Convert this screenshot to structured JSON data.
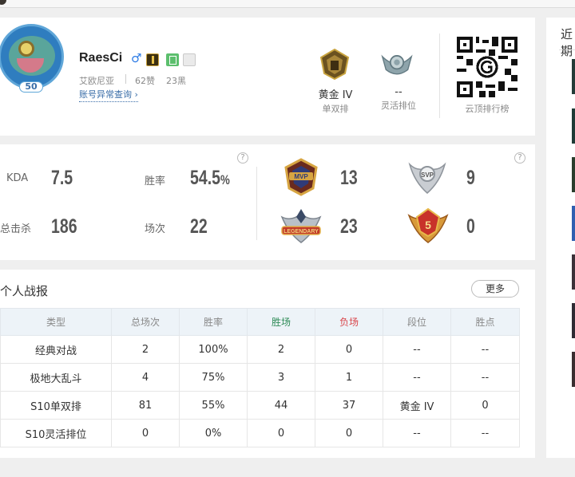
{
  "profile": {
    "name": "RaesCi",
    "gender_symbol": "♂",
    "server": "艾欧尼亚",
    "likes": "62赞",
    "blacks": "23黑",
    "account_check": "账号异常查询 ›",
    "level": "50"
  },
  "ranks": [
    {
      "title": "黄金 IV",
      "subtitle": "单双排",
      "emblem": "gold-rank-emblem"
    },
    {
      "title": "--",
      "subtitle": "灵活排位",
      "emblem": "unranked-emblem"
    }
  ],
  "qr": {
    "caption": "云顶排行榜"
  },
  "stats": {
    "kda_label": "KDA",
    "kda_value": "7.5",
    "winrate_label": "胜率",
    "winrate_value": "54.5",
    "winrate_unit": "%",
    "kills_label": "总击杀",
    "kills_value": "186",
    "games_label": "场次",
    "games_value": "22"
  },
  "medals": [
    {
      "name": "mvp-medal",
      "count": "13"
    },
    {
      "name": "svp-medal",
      "count": "9"
    },
    {
      "name": "legendary-medal",
      "count": "23"
    },
    {
      "name": "pentakill-medal",
      "count": "0"
    }
  ],
  "report": {
    "title": "个人战报",
    "more_label": "更多",
    "columns": [
      "类型",
      "总场次",
      "胜率",
      "胜场",
      "负场",
      "段位",
      "胜点"
    ],
    "rows": [
      [
        "经典对战",
        "2",
        "100%",
        "2",
        "0",
        "--",
        "--"
      ],
      [
        "极地大乱斗",
        "4",
        "75%",
        "3",
        "1",
        "--",
        "--"
      ],
      [
        "S10单双排",
        "81",
        "55%",
        "44",
        "37",
        "黄金 IV",
        "0"
      ],
      [
        "S10灵活排位",
        "0",
        "0%",
        "0",
        "0",
        "--",
        "--"
      ]
    ]
  },
  "side": {
    "title": "近期"
  },
  "colors": {
    "win": "#2e8b57",
    "lose": "#d9464b",
    "link": "#3a6ea8",
    "header_bg": "#edf3f8"
  }
}
